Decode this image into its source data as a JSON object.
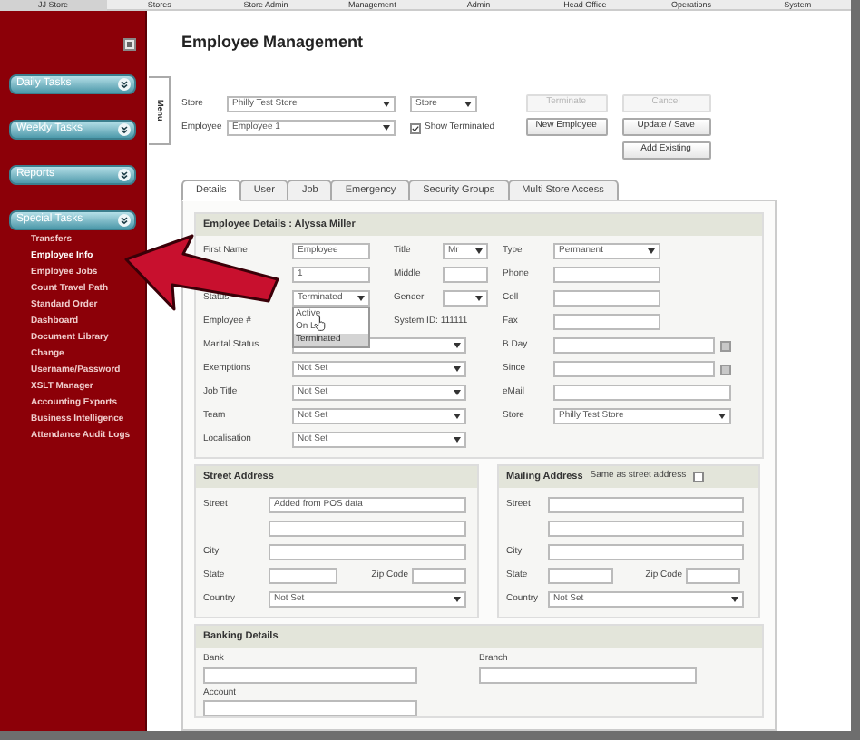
{
  "nav": [
    {
      "label": "JJ Store",
      "selected": true
    },
    {
      "label": "Stores",
      "selected": false
    },
    {
      "label": "Store Admin",
      "selected": false
    },
    {
      "label": "Management",
      "selected": false
    },
    {
      "label": "Admin",
      "selected": false
    },
    {
      "label": "Head Office",
      "selected": false
    },
    {
      "label": "Operations",
      "selected": false
    },
    {
      "label": "System",
      "selected": false
    }
  ],
  "sections": [
    {
      "label": "Daily Tasks"
    },
    {
      "label": "Weekly Tasks"
    },
    {
      "label": "Reports"
    },
    {
      "label": "Special Tasks",
      "items": [
        {
          "label": "Transfers",
          "selected": false
        },
        {
          "label": "Employee Info",
          "selected": true
        },
        {
          "label": "Employee Jobs",
          "selected": false
        },
        {
          "label": "Count Travel Path",
          "selected": false
        },
        {
          "label": "Standard Order",
          "selected": false
        },
        {
          "label": "Dashboard",
          "selected": false
        },
        {
          "label": "Document Library",
          "selected": false
        },
        {
          "label": "Change Username/Password",
          "selected": false
        },
        {
          "label": "XSLT Manager",
          "selected": false
        },
        {
          "label": "Accounting Exports",
          "selected": false
        },
        {
          "label": "Business Intelligence",
          "selected": false
        },
        {
          "label": "Attendance Audit Logs",
          "selected": false
        }
      ]
    }
  ],
  "menu_tab": "Menu",
  "title": "Employee Management",
  "filters": {
    "store_label": "Store",
    "store_value": "Philly Test Store",
    "store_type_value": "Store",
    "employee_label": "Employee",
    "employee_value": "Employee 1",
    "show_terminated": {
      "label": "Show Terminated",
      "checked": true
    }
  },
  "buttons": [
    {
      "label": "Terminate",
      "disabled": true
    },
    {
      "label": "Cancel",
      "disabled": true
    },
    {
      "label": "New Employee",
      "disabled": false
    },
    {
      "label": "Update / Save",
      "disabled": false
    },
    {
      "label": "Add Existing",
      "disabled": false
    }
  ],
  "tabs": [
    {
      "label": "Details",
      "selected": true
    },
    {
      "label": "User",
      "selected": false
    },
    {
      "label": "Job",
      "selected": false
    },
    {
      "label": "Emergency",
      "selected": false
    },
    {
      "label": "Security Groups",
      "selected": false
    },
    {
      "label": "Multi Store Access",
      "selected": false
    }
  ],
  "details": {
    "title": "Employee Details : Alyssa Miller",
    "rows": [
      {
        "cells": [
          {
            "label": "First Name",
            "kind": "text",
            "value": "Employee"
          },
          {
            "label": "Title",
            "kind": "select",
            "value": "Mr"
          },
          {
            "label": "Type",
            "kind": "select",
            "value": "Permanent"
          }
        ]
      },
      {
        "cells": [
          {
            "kind": "text",
            "value": "1"
          },
          {
            "label": "Middle",
            "kind": "text"
          },
          {
            "label": "Phone",
            "kind": "text"
          }
        ]
      },
      {
        "cells": [
          {
            "label": "Status",
            "kind": "select",
            "value": "Terminated",
            "options": [
              {
                "label": "Active",
                "selected": false
              },
              {
                "label": "On L",
                "selected": false
              },
              {
                "label": "Terminated",
                "selected": true
              }
            ]
          },
          {
            "label": "Gender",
            "kind": "select"
          },
          {
            "label": "Cell",
            "kind": "text"
          }
        ]
      },
      {
        "cells": [
          {
            "label": "Employee #"
          },
          {
            "label": "System ID: 111111",
            "kind": "note"
          },
          {
            "label": "Fax",
            "kind": "text"
          }
        ]
      },
      {
        "cells": [
          {
            "label": "Marital Status",
            "kind": "select"
          },
          {
            "label": "B Day",
            "kind": "date"
          }
        ]
      },
      {
        "cells": [
          {
            "label": "Exemptions",
            "kind": "select",
            "value": "Not Set"
          },
          {
            "label": "Since",
            "kind": "date"
          }
        ]
      },
      {
        "cells": [
          {
            "label": "Job Title",
            "kind": "select",
            "value": "Not Set"
          },
          {
            "label": "eMail",
            "kind": "text"
          }
        ]
      },
      {
        "cells": [
          {
            "label": "Team",
            "kind": "select",
            "value": "Not Set"
          },
          {
            "label": "Store",
            "kind": "select",
            "value": "Philly Test Store"
          }
        ]
      },
      {
        "cells": [
          {
            "label": "Localisation",
            "kind": "select",
            "value": "Not Set"
          }
        ]
      }
    ]
  },
  "street_address": {
    "title": "Street Address",
    "street_label": "Street",
    "street_value": "Added from POS data",
    "city_label": "City",
    "state_label": "State",
    "zip_label": "Zip Code",
    "country_label": "Country",
    "country_value": "Not Set"
  },
  "mailing_address": {
    "title": "Mailing Address",
    "same_as_street": {
      "label": "Same as street address",
      "checked": false
    },
    "street_label": "Street",
    "city_label": "City",
    "state_label": "State",
    "zip_label": "Zip Code",
    "country_label": "Country",
    "country_value": "Not Set"
  },
  "banking": {
    "title": "Banking Details",
    "bank_label": "Bank",
    "branch_label": "Branch",
    "account_label": "Account"
  }
}
